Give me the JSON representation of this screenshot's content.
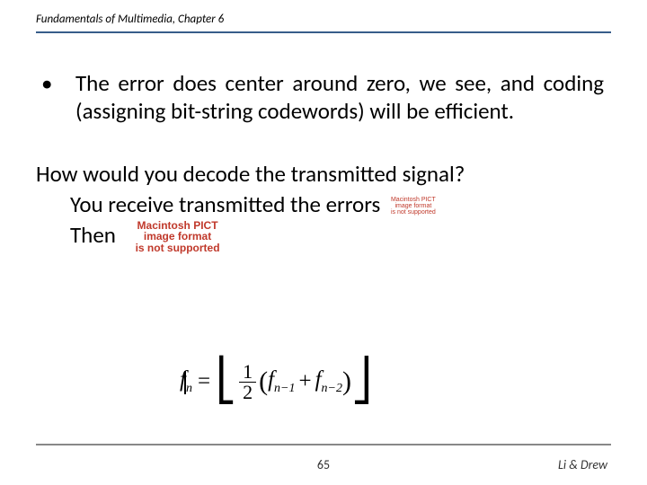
{
  "header": {
    "text": "Fundamentals of Multimedia, Chapter 6"
  },
  "bullet": {
    "marker": "•",
    "text": "The error does center around zero, we see, and coding (assigning bit-string codewords) will be efficient."
  },
  "question": {
    "line1": "How would you decode the transmitted signal?",
    "line2": "You receive transmitted the errors",
    "line3": "Then"
  },
  "pict_error": {
    "small": "Macintosh PICT\nimage format\nis not supported",
    "big": "Macintosh PICT\nimage format\nis not supported"
  },
  "formula": {
    "lhs_var": "f",
    "lhs_sub": "n",
    "frac_num": "1",
    "frac_den": "2",
    "term1_var": "f",
    "term1_sub": "n−1",
    "plus": "+",
    "term2_var": "f",
    "term2_sub": "n−2"
  },
  "footer": {
    "page": "65",
    "authors": "Li & Drew"
  }
}
